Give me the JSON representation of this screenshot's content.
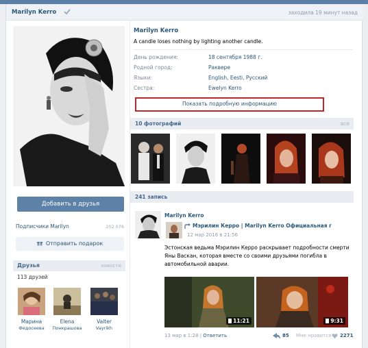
{
  "header": {
    "name": "Marilyn Kerro",
    "last_seen": "заходила 19 минут назад"
  },
  "sidebar": {
    "add_friend_button": "Добавить в друзья",
    "subscribers_label": "Подписчики Marilyn",
    "subscribers_count": "202 076",
    "gift_button": "Отправить подарок",
    "friends_title": "Друзья",
    "friends_news": "новости",
    "friends_count": "113 друзей",
    "friends": [
      {
        "name": "Марина",
        "surname": "Федосеева"
      },
      {
        "name": "Elena",
        "surname": "Понкрашова"
      },
      {
        "name": "Valter",
        "surname": "Vayrikh"
      }
    ]
  },
  "profile": {
    "name": "Marilyn Kerro",
    "status": "A candle loses nothing by lighting another candle.",
    "info": [
      {
        "label": "День рождения:",
        "value": "18 сентября 1988 г."
      },
      {
        "label": "Родной город:",
        "value": "Раквере"
      },
      {
        "label": "Языки:",
        "value": "English, Eesti, Русский"
      },
      {
        "label": "Сестра:",
        "value": "Ewelyn Kerro"
      }
    ],
    "show_more": "Показать подробную информацию"
  },
  "photos": {
    "title": "10 фотографий",
    "all_link": "все"
  },
  "wall": {
    "title": "241 запись",
    "post": {
      "author": "Marilyn Kerro",
      "repost_source": "Мэрилин Керро | Marilyn Kerro Официальная г",
      "repost_date": "12 мар 2016 в 21:56",
      "text": "Эстонская ведьма Мэрилин Керро раскрывает подробности смерти Яны Васкан, которая вместе со своими друзьями погибла в автомобильной аварии.",
      "videos": [
        {
          "duration": "11:21"
        },
        {
          "duration": "9:31"
        }
      ],
      "footer": {
        "date": "13 мар в 1:28",
        "separator": "|",
        "reply": "Ответить",
        "shares": "85",
        "like_label": "Мне нравится",
        "likes": "2271"
      }
    }
  },
  "colors": {
    "link": "#2b587a",
    "button": "#5e81a8",
    "highlight_border": "#c0252b"
  }
}
